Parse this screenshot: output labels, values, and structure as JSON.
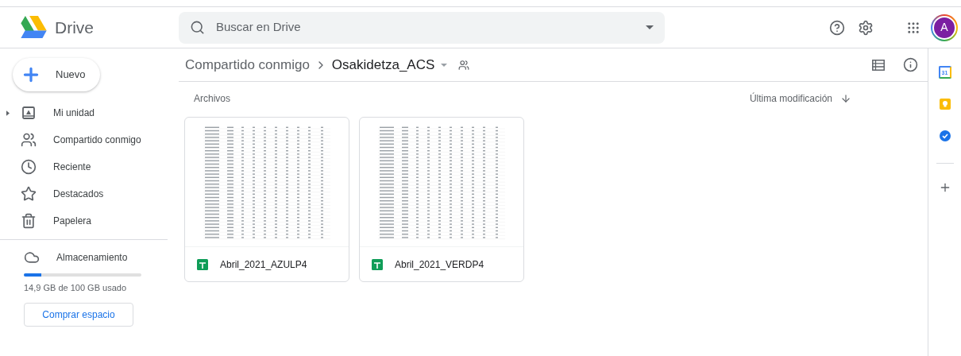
{
  "header": {
    "app_name": "Drive",
    "search": {
      "placeholder": "Buscar en Drive"
    },
    "avatar": "A"
  },
  "sidebar": {
    "new_button": "Nuevo",
    "items": [
      {
        "kind": "drive",
        "label": "Mi unidad",
        "selected": false,
        "expanded": false
      },
      {
        "kind": "shared",
        "label": "Compartido conmigo",
        "selected": false
      },
      {
        "kind": "recent",
        "label": "Reciente",
        "selected": false
      },
      {
        "kind": "starred",
        "label": "Destacados",
        "selected": false
      },
      {
        "kind": "trash",
        "label": "Papelera",
        "selected": false
      }
    ],
    "storage": {
      "label": "Almacenamiento",
      "level": 0.15,
      "usage": "14,9 GB de 100 GB usado",
      "buy_button": "Comprar espacio"
    }
  },
  "breadcrumb": [
    "Compartido conmigo",
    "Osakidetza_ACS"
  ],
  "files_section": {
    "title": "Archivos",
    "sort": "Última modificación",
    "files": [
      {
        "name": "Abril_2021_AZULP4"
      },
      {
        "name": "Abril_2021_VERDP4"
      }
    ]
  },
  "side_apps": [
    {
      "kind": "calendar",
      "label": "31"
    },
    {
      "kind": "keep"
    },
    {
      "kind": "tasks"
    }
  ]
}
